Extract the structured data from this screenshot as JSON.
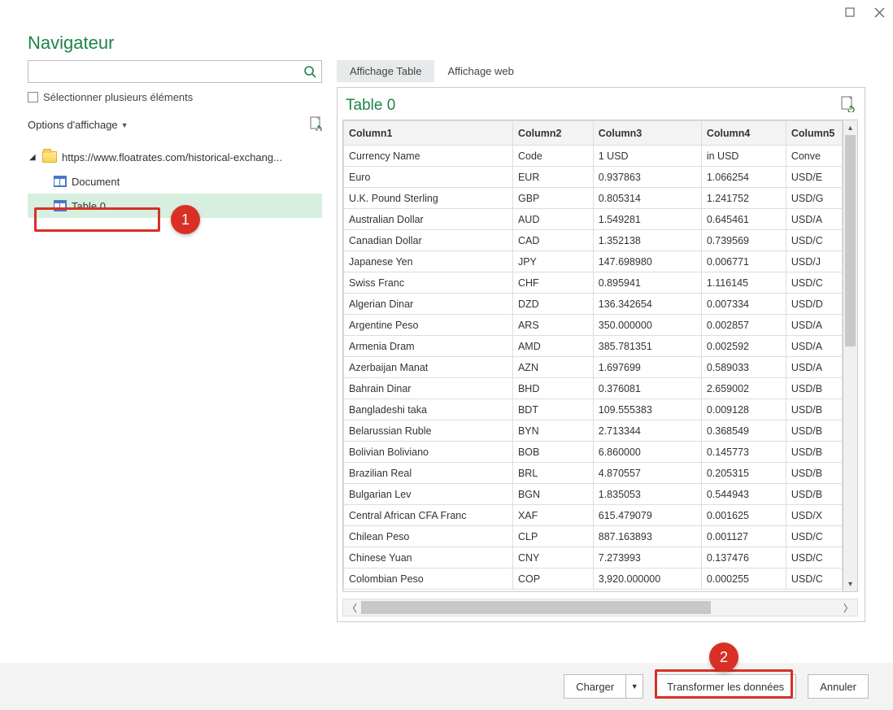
{
  "window": {
    "title": "Navigateur"
  },
  "left": {
    "search_placeholder": "",
    "multiselect_label": "Sélectionner plusieurs éléments",
    "display_options_label": "Options d'affichage",
    "tree": {
      "root_label": "https://www.floatrates.com/historical-exchang...",
      "items": [
        {
          "label": "Document"
        },
        {
          "label": "Table 0"
        }
      ]
    }
  },
  "tabs": {
    "table": "Affichage Table",
    "web": "Affichage web"
  },
  "preview": {
    "title": "Table 0"
  },
  "table": {
    "headers": [
      "Column1",
      "Column2",
      "Column3",
      "Column4",
      "Column5"
    ],
    "rows": [
      [
        "Currency Name",
        "Code",
        "1 USD",
        "in USD",
        "Conve"
      ],
      [
        "Euro",
        "EUR",
        "0.937863",
        "1.066254",
        "USD/E"
      ],
      [
        "U.K. Pound Sterling",
        "GBP",
        "0.805314",
        "1.241752",
        "USD/G"
      ],
      [
        "Australian Dollar",
        "AUD",
        "1.549281",
        "0.645461",
        "USD/A"
      ],
      [
        "Canadian Dollar",
        "CAD",
        "1.352138",
        "0.739569",
        "USD/C"
      ],
      [
        "Japanese Yen",
        "JPY",
        "147.698980",
        "0.006771",
        "USD/J"
      ],
      [
        "Swiss Franc",
        "CHF",
        "0.895941",
        "1.116145",
        "USD/C"
      ],
      [
        "Algerian Dinar",
        "DZD",
        "136.342654",
        "0.007334",
        "USD/D"
      ],
      [
        "Argentine Peso",
        "ARS",
        "350.000000",
        "0.002857",
        "USD/A"
      ],
      [
        "Armenia Dram",
        "AMD",
        "385.781351",
        "0.002592",
        "USD/A"
      ],
      [
        "Azerbaijan Manat",
        "AZN",
        "1.697699",
        "0.589033",
        "USD/A"
      ],
      [
        "Bahrain Dinar",
        "BHD",
        "0.376081",
        "2.659002",
        "USD/B"
      ],
      [
        "Bangladeshi taka",
        "BDT",
        "109.555383",
        "0.009128",
        "USD/B"
      ],
      [
        "Belarussian Ruble",
        "BYN",
        "2.713344",
        "0.368549",
        "USD/B"
      ],
      [
        "Bolivian Boliviano",
        "BOB",
        "6.860000",
        "0.145773",
        "USD/B"
      ],
      [
        "Brazilian Real",
        "BRL",
        "4.870557",
        "0.205315",
        "USD/B"
      ],
      [
        "Bulgarian Lev",
        "BGN",
        "1.835053",
        "0.544943",
        "USD/B"
      ],
      [
        "Central African CFA Franc",
        "XAF",
        "615.479079",
        "0.001625",
        "USD/X"
      ],
      [
        "Chilean Peso",
        "CLP",
        "887.163893",
        "0.001127",
        "USD/C"
      ],
      [
        "Chinese Yuan",
        "CNY",
        "7.273993",
        "0.137476",
        "USD/C"
      ],
      [
        "Colombian Peso",
        "COP",
        "3,920.000000",
        "0.000255",
        "USD/C"
      ]
    ]
  },
  "footer": {
    "load": "Charger",
    "transform": "Transformer les données",
    "cancel": "Annuler"
  },
  "annotations": {
    "badge1": "1",
    "badge2": "2"
  }
}
